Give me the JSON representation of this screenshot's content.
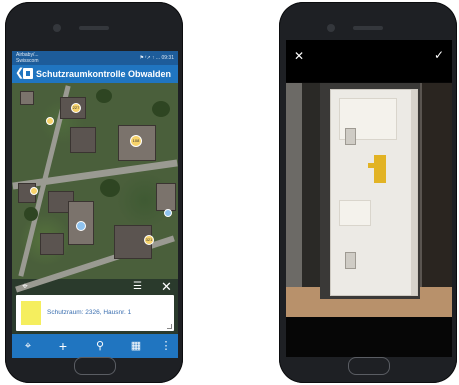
{
  "left_phone": {
    "status_bar": {
      "carrier_line1": "Airbaby/...",
      "carrier_line2": "Swisscom",
      "indicators": "⚑ ᶠ↗ ↑ ... 09:31"
    },
    "app_bar": {
      "back_glyph": "❮",
      "title": "Schutzraumkontrolle Obwalden"
    },
    "map_markers": [
      "227",
      "108",
      "321",
      "",
      "",
      "",
      ""
    ],
    "tool_row": {
      "pin_glyph": "⌖",
      "list_glyph": "☰",
      "close_glyph": "✕"
    },
    "info_card": {
      "text": "Schutzraum: 2326, Hausnr. 1",
      "swatch_color": "#f5ee5e"
    },
    "bottom_bar": {
      "locate_glyph": "⌖",
      "add_glyph": "+",
      "search_glyph": "⚲",
      "layers_glyph": "▦",
      "more_glyph": "⋮"
    }
  },
  "right_phone": {
    "top_bar": {
      "cancel_glyph": "✕",
      "confirm_glyph": "✓"
    }
  },
  "colors": {
    "app_blue": "#2075c0",
    "status_blue": "#1d5c9a",
    "phone_body": "#1e2024"
  }
}
